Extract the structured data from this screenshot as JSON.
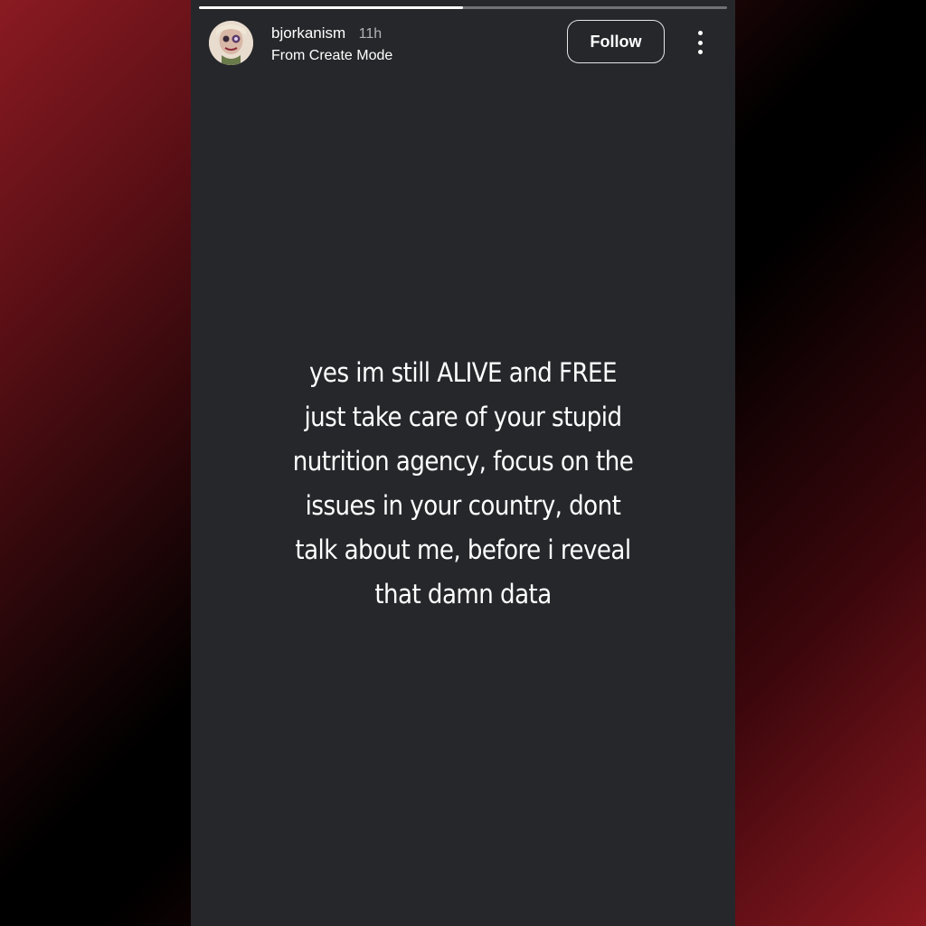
{
  "story": {
    "progress": 0.5,
    "header": {
      "username": "bjorkanism",
      "time": "11h",
      "subtitle": "From Create Mode",
      "follow_label": "Follow",
      "avatar_icon": "avatar-portrait-icon",
      "more_icon": "more-vertical-icon"
    },
    "text_lines": [
      "yes im still ALIVE and FREE",
      "just take care of your stupid",
      "nutrition agency, focus on the",
      "issues in your country, dont",
      "talk about me, before i reveal",
      "that damn data"
    ],
    "background_color": "#26272b"
  }
}
